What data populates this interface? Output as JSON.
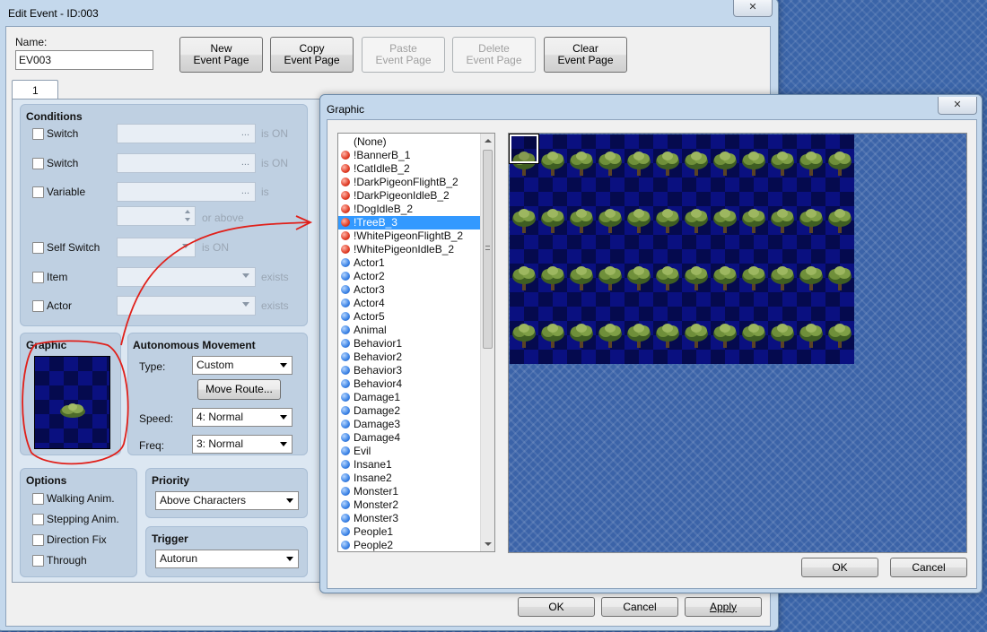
{
  "edit_event": {
    "title": "Edit Event - ID:003",
    "close_glyph": "✕",
    "name_label": "Name:",
    "name_value": "EV003",
    "buttons": {
      "new_page": [
        "New",
        "Event Page"
      ],
      "copy_page": [
        "Copy",
        "Event Page"
      ],
      "paste_page": [
        "Paste",
        "Event Page"
      ],
      "delete_page": [
        "Delete",
        "Event Page"
      ],
      "clear_page": [
        "Clear",
        "Event Page"
      ]
    },
    "tab_label": "1",
    "conditions": {
      "heading": "Conditions",
      "switch1": "Switch",
      "switch2": "Switch",
      "variable": "Variable",
      "self_switch": "Self Switch",
      "item": "Item",
      "actor": "Actor",
      "is_on": "is ON",
      "is": "is",
      "or_above": "or above",
      "exists": "exists",
      "dots": "..."
    },
    "graphic_heading": "Graphic",
    "autonomous": {
      "heading": "Autonomous Movement",
      "type_label": "Type:",
      "type_value": "Custom",
      "move_route": "Move Route...",
      "speed_label": "Speed:",
      "speed_value": "4: Normal",
      "freq_label": "Freq:",
      "freq_value": "3: Normal"
    },
    "options": {
      "heading": "Options",
      "items": [
        "Walking Anim.",
        "Stepping Anim.",
        "Direction Fix",
        "Through"
      ]
    },
    "priority": {
      "heading": "Priority",
      "value": "Above Characters"
    },
    "trigger": {
      "heading": "Trigger",
      "value": "Autorun"
    },
    "footer": {
      "ok": "OK",
      "cancel": "Cancel",
      "apply": "Apply"
    }
  },
  "graphic_dialog": {
    "title": "Graphic",
    "close_glyph": "✕",
    "files": [
      {
        "name": "(None)",
        "icon": "none"
      },
      {
        "name": "!BannerB_1",
        "icon": "red"
      },
      {
        "name": "!CatIdleB_2",
        "icon": "red"
      },
      {
        "name": "!DarkPigeonFlightB_2",
        "icon": "red"
      },
      {
        "name": "!DarkPigeonIdleB_2",
        "icon": "red"
      },
      {
        "name": "!DogIdleB_2",
        "icon": "red"
      },
      {
        "name": "!TreeB_3",
        "icon": "red",
        "selected": true
      },
      {
        "name": "!WhitePigeonFlightB_2",
        "icon": "red"
      },
      {
        "name": "!WhitePigeonIdleB_2",
        "icon": "red"
      },
      {
        "name": "Actor1",
        "icon": "blue"
      },
      {
        "name": "Actor2",
        "icon": "blue"
      },
      {
        "name": "Actor3",
        "icon": "blue"
      },
      {
        "name": "Actor4",
        "icon": "blue"
      },
      {
        "name": "Actor5",
        "icon": "blue"
      },
      {
        "name": "Animal",
        "icon": "blue"
      },
      {
        "name": "Behavior1",
        "icon": "blue"
      },
      {
        "name": "Behavior2",
        "icon": "blue"
      },
      {
        "name": "Behavior3",
        "icon": "blue"
      },
      {
        "name": "Behavior4",
        "icon": "blue"
      },
      {
        "name": "Damage1",
        "icon": "blue"
      },
      {
        "name": "Damage2",
        "icon": "blue"
      },
      {
        "name": "Damage3",
        "icon": "blue"
      },
      {
        "name": "Damage4",
        "icon": "blue"
      },
      {
        "name": "Evil",
        "icon": "blue"
      },
      {
        "name": "Insane1",
        "icon": "blue"
      },
      {
        "name": "Insane2",
        "icon": "blue"
      },
      {
        "name": "Monster1",
        "icon": "blue"
      },
      {
        "name": "Monster2",
        "icon": "blue"
      },
      {
        "name": "Monster3",
        "icon": "blue"
      },
      {
        "name": "People1",
        "icon": "blue"
      },
      {
        "name": "People2",
        "icon": "blue"
      }
    ],
    "sprite_sheet": {
      "columns": 12,
      "rows": 4,
      "selected_index": 0
    },
    "ok": "OK",
    "cancel": "Cancel"
  },
  "colors": {
    "selection": "#3399ff",
    "annotation": "#e0201a",
    "checker_dark": "#050a4e",
    "checker_light": "#0a1080"
  }
}
